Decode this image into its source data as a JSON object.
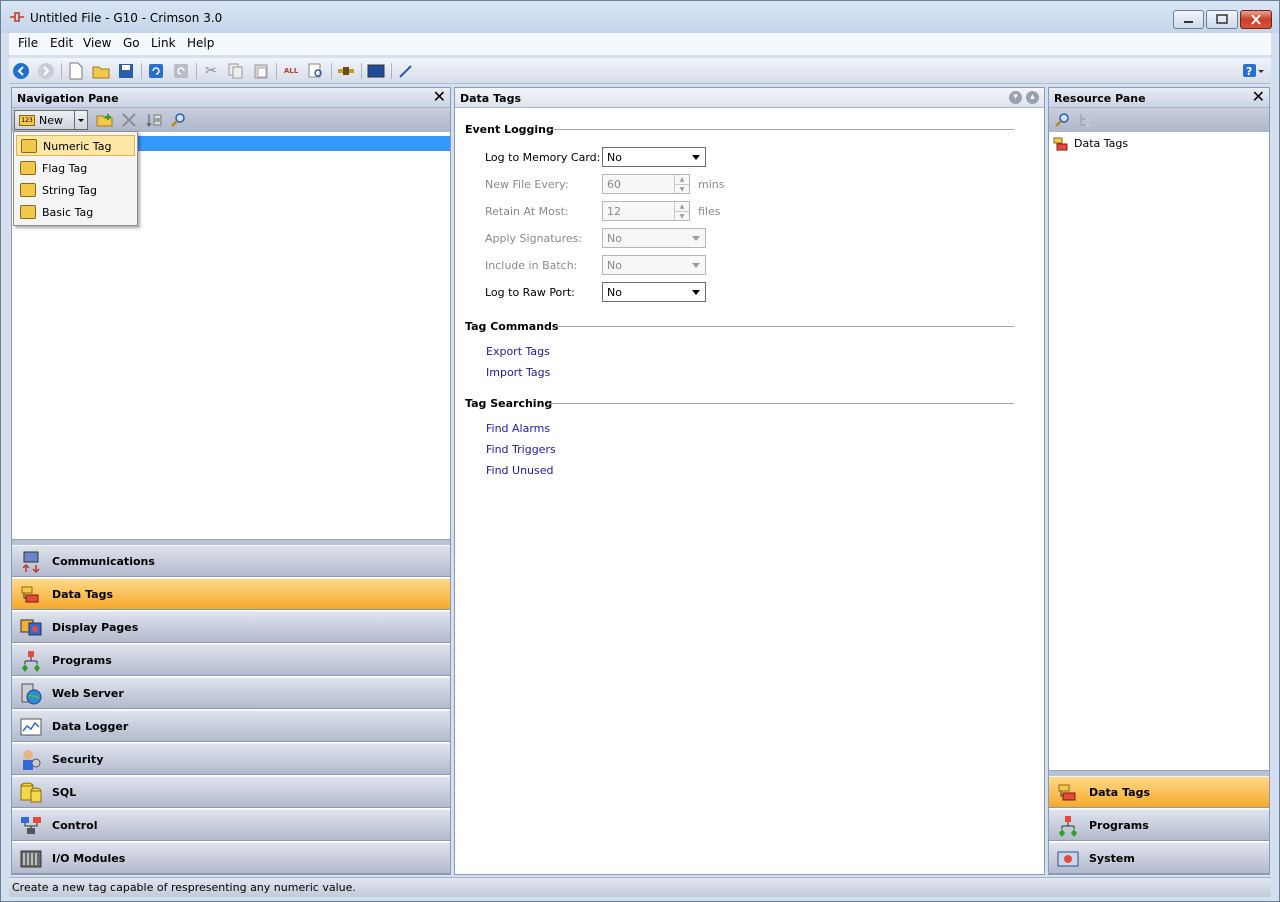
{
  "window": {
    "title": "Untitled File - G10 - Crimson 3.0"
  },
  "menu": [
    "File",
    "Edit",
    "View",
    "Go",
    "Link",
    "Help"
  ],
  "toolbar": {
    "icons": [
      "back-icon",
      "forward-icon",
      "new-file-icon",
      "open-folder-icon",
      "save-icon",
      "undo-icon",
      "redo-icon",
      "cut-icon",
      "copy-icon",
      "paste-icon",
      "translate-all-icon",
      "find-icon",
      "link-icon",
      "display-icon",
      "wand-icon"
    ],
    "help_icon": "help-icon"
  },
  "nav_pane": {
    "title": "Navigation Pane",
    "new_button": "New",
    "new_menu": [
      {
        "label": "Numeric Tag",
        "color": "#f2c94c"
      },
      {
        "label": "Flag Tag",
        "color": "#f2c94c"
      },
      {
        "label": "String Tag",
        "color": "#f2c94c"
      },
      {
        "label": "Basic Tag",
        "color": "#f2c94c"
      }
    ],
    "categories": [
      {
        "label": "Communications",
        "icon": "communications-icon"
      },
      {
        "label": "Data Tags",
        "icon": "data-tags-icon",
        "active": true
      },
      {
        "label": "Display Pages",
        "icon": "display-pages-icon"
      },
      {
        "label": "Programs",
        "icon": "programs-icon"
      },
      {
        "label": "Web Server",
        "icon": "web-server-icon"
      },
      {
        "label": "Data Logger",
        "icon": "data-logger-icon"
      },
      {
        "label": "Security",
        "icon": "security-icon"
      },
      {
        "label": "SQL",
        "icon": "sql-icon"
      },
      {
        "label": "Control",
        "icon": "control-icon"
      },
      {
        "label": "I/O Modules",
        "icon": "io-modules-icon"
      }
    ]
  },
  "center": {
    "title": "Data Tags",
    "sections": {
      "event_logging": "Event Logging",
      "tag_commands": "Tag Commands",
      "tag_searching": "Tag Searching"
    },
    "fields": {
      "log_memory_card": {
        "label": "Log to Memory Card:",
        "value": "No"
      },
      "new_file_every": {
        "label": "New File Every:",
        "value": "60",
        "unit": "mins"
      },
      "retain_at_most": {
        "label": "Retain At Most:",
        "value": "12",
        "unit": "files"
      },
      "apply_signatures": {
        "label": "Apply Signatures:",
        "value": "No"
      },
      "include_in_batch": {
        "label": "Include in Batch:",
        "value": "No"
      },
      "log_raw_port": {
        "label": "Log to Raw Port:",
        "value": "No"
      }
    },
    "commands": [
      "Export Tags",
      "Import Tags"
    ],
    "searching": [
      "Find Alarms",
      "Find Triggers",
      "Find Unused"
    ]
  },
  "resource_pane": {
    "title": "Resource Pane",
    "tree_item": "Data Tags",
    "categories": [
      {
        "label": "Data Tags",
        "icon": "data-tags-icon",
        "active": true
      },
      {
        "label": "Programs",
        "icon": "programs-icon"
      },
      {
        "label": "System",
        "icon": "system-icon"
      }
    ]
  },
  "status": "Create a new tag capable of respresenting any numeric value."
}
